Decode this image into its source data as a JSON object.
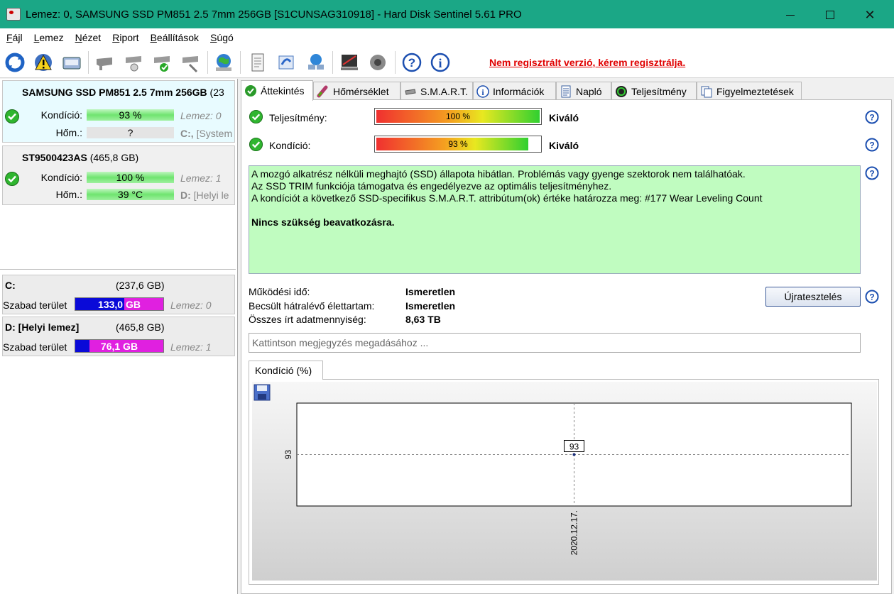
{
  "window": {
    "title": "Lemez: 0, SAMSUNG SSD PM851 2.5 7mm 256GB [S1CUNSAG310918]  -  Hard Disk Sentinel 5.61 PRO"
  },
  "menu": [
    {
      "pre": "",
      "u": "F",
      "post": "ájl"
    },
    {
      "pre": "",
      "u": "L",
      "post": "emez"
    },
    {
      "pre": "",
      "u": "N",
      "post": "ézet"
    },
    {
      "pre": "",
      "u": "R",
      "post": "iport"
    },
    {
      "pre": "",
      "u": "B",
      "post": "eállítások"
    },
    {
      "pre": "",
      "u": "S",
      "post": "úgó"
    }
  ],
  "toolbar": {
    "register_link": "Nem regisztrált verzió, kérem regisztrálja.",
    "icons": [
      "refresh-icon",
      "warning-icon",
      "disk-report-icon",
      "drive-icon",
      "drive-test-icon",
      "drive-check-icon",
      "drive-tools-icon",
      "update-icon",
      "document-icon",
      "sync-icon",
      "network-icon",
      "monitor-icon",
      "speaker-icon",
      "help-icon",
      "info-icon"
    ]
  },
  "disks": [
    {
      "name": "SAMSUNG SSD PM851 2.5 7mm 256GB",
      "size": "(23",
      "condition_label": "Kondíció:",
      "condition": "93 %",
      "condition_info": "Lemez: 0",
      "temp_label": "Hőm.:",
      "temp": "?",
      "temp_info_drive": "C:,",
      "temp_info": "[System"
    },
    {
      "name": "ST9500423AS",
      "size": "(465,8 GB)",
      "condition_label": "Kondíció:",
      "condition": "100 %",
      "condition_info": "Lemez: 1",
      "temp_label": "Hőm.:",
      "temp": "39 °C",
      "temp_info_drive": "D:",
      "temp_info": "[Helyi le"
    }
  ],
  "volumes": [
    {
      "name": "C:",
      "size": "(237,6 GB)",
      "free_label": "Szabad terület",
      "free": "133,0 GB",
      "free_fraction": 0.56,
      "disk": "Lemez: 0"
    },
    {
      "name": "D: [Helyi lemez]",
      "size": "(465,8 GB)",
      "free_label": "Szabad terület",
      "free": "76,1 GB",
      "free_fraction": 0.16,
      "disk": "Lemez: 1"
    }
  ],
  "tabs": [
    {
      "label": "Áttekintés",
      "icon": "check-icon"
    },
    {
      "label": "Hőmérséklet",
      "icon": "thermometer-icon"
    },
    {
      "label": "S.M.A.R.T.",
      "icon": "drive-icon"
    },
    {
      "label": "Információk",
      "icon": "info-icon"
    },
    {
      "label": "Napló",
      "icon": "log-icon"
    },
    {
      "label": "Teljesítmény",
      "icon": "gauge-icon"
    },
    {
      "label": "Figyelmeztetések",
      "icon": "alerts-icon"
    }
  ],
  "overview": {
    "performance_label": "Teljesítmény:",
    "performance": "100 %",
    "performance_fraction": 1.0,
    "performance_rating": "Kiváló",
    "condition_label": "Kondíció:",
    "condition": "93 %",
    "condition_fraction": 0.93,
    "condition_rating": "Kiváló",
    "status_lines": [
      "A mozgó alkatrész nélküli meghajtó (SSD) állapota hibátlan. Problémás vagy gyenge szektorok nem találhatóak.",
      "Az SSD TRIM funkciója támogatva és engedélyezve az optimális teljesítményhez.",
      "A kondíciót a következő SSD-specifikus S.M.A.R.T. attribútum(ok) értéke határozza meg:  #177 Wear Leveling Count"
    ],
    "verdict": "Nincs szükség beavatkozásra.",
    "uptime_label": "Működési idő:",
    "uptime": "Ismeretlen",
    "remaining_label": "Becsült hátralévő élettartam:",
    "remaining": "Ismeretlen",
    "written_label": "Összes írt adatmennyiség:",
    "written": "8,63 TB",
    "retest_button": "Újratesztelés",
    "note_placeholder": "Kattintson megjegyzés megadásához ..."
  },
  "chart_tab": "Kondíció  (%)",
  "chart_data": {
    "type": "line",
    "x": [
      "2020.12.17."
    ],
    "series": [
      {
        "values": [
          93
        ]
      }
    ],
    "ytick": "93",
    "xtick": "2020.12.17.",
    "point_label": "93",
    "grid": true
  }
}
